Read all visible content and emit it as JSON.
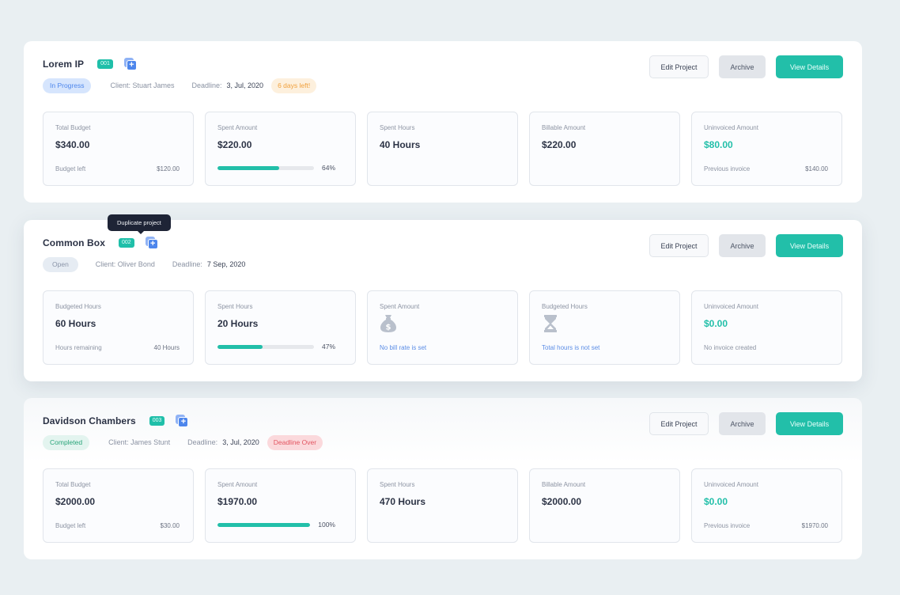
{
  "tooltip": "Duplicate project",
  "actions": {
    "edit": "Edit Project",
    "archive": "Archive",
    "view": "View Details"
  },
  "projects": [
    {
      "name": "Lorem IP",
      "id": "001",
      "status": "In Progress",
      "client": "Client: Stuart James",
      "deadline_label": "Deadline:",
      "deadline": "3, Jul, 2020",
      "deadline_note": "6 days left!",
      "stats": [
        {
          "label": "Total Budget",
          "value": "$340.00",
          "foot_label": "Budget left",
          "foot_value": "$120.00"
        },
        {
          "label": "Spent Amount",
          "value": "$220.00",
          "progress": 64,
          "progress_label": "64%"
        },
        {
          "label": "Spent Hours",
          "value": "40 Hours"
        },
        {
          "label": "Billable Amount",
          "value": "$220.00"
        },
        {
          "label": "Uninvoiced Amount",
          "value": "$80.00",
          "foot_label": "Previous invoice",
          "foot_value": "$140.00"
        }
      ]
    },
    {
      "name": "Common Box",
      "id": "002",
      "status": "Open",
      "client": "Client: Oliver Bond",
      "deadline_label": "Deadline:",
      "deadline": "7 Sep, 2020",
      "stats": [
        {
          "label": "Budgeted Hours",
          "value": "60 Hours",
          "foot_label": "Hours remaining",
          "foot_value": "40 Hours"
        },
        {
          "label": "Spent Hours",
          "value": "20 Hours",
          "progress": 47,
          "progress_label": "47%"
        },
        {
          "label": "Spent Amount",
          "icon": "money-bag-icon",
          "note": "No bill rate is set"
        },
        {
          "label": "Budgeted Hours",
          "icon": "hourglass-icon",
          "note": "Total hours is not set"
        },
        {
          "label": "Uninvoiced Amount",
          "value": "$0.00",
          "foot_label": "No invoice created"
        }
      ]
    },
    {
      "name": "Davidson Chambers",
      "id": "003",
      "status": "Completed",
      "client": "Client: James Stunt",
      "deadline_label": "Deadline:",
      "deadline": "3, Jul, 2020",
      "deadline_note": "Deadline Over",
      "stats": [
        {
          "label": "Total Budget",
          "value": "$2000.00",
          "foot_label": "Budget left",
          "foot_value": "$30.00"
        },
        {
          "label": "Spent Amount",
          "value": "$1970.00",
          "progress": 100,
          "progress_label": "100%"
        },
        {
          "label": "Spent Hours",
          "value": "470 Hours"
        },
        {
          "label": "Billable Amount",
          "value": "$2000.00"
        },
        {
          "label": "Uninvoiced Amount",
          "value": "$0.00",
          "foot_label": "Previous invoice",
          "foot_value": "$1970.00"
        }
      ]
    }
  ],
  "colors": {
    "accent": "#22bfa9",
    "primary": "#4d86ec",
    "warning": "#f0a03c",
    "danger": "#e25561"
  }
}
